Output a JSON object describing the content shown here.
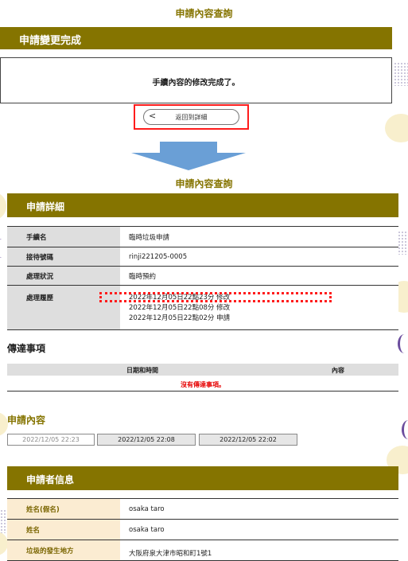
{
  "header": {
    "title": "申請內容查詢"
  },
  "banner": {
    "label": "申請變更完成"
  },
  "completion": {
    "message": "手續內容的修改完成了。"
  },
  "back_button": {
    "chevron": "<",
    "label": "返回到詳細"
  },
  "detail_section": {
    "title": "申請內容查詢",
    "band_label": "申請詳細",
    "rows": [
      {
        "label": "手續名",
        "value": "臨時垃圾申請"
      },
      {
        "label": "接待號碼",
        "value": "rinji221205-0005"
      },
      {
        "label": "處理狀況",
        "value": "臨時預約"
      },
      {
        "label": "處理履歷",
        "history": [
          "2022年12月05日22點23分 修改",
          "2022年12月05日22點08分 修改",
          "2022年12月05日22點02分 申請"
        ]
      }
    ]
  },
  "messages": {
    "heading": "傳達事項",
    "col_datetime": "日期和時間",
    "col_content": "內容",
    "empty": "沒有傳達事項。"
  },
  "application_content": {
    "heading": "申請內容",
    "versions": [
      "2022/12/05 22:23",
      "2022/12/05 22:08",
      "2022/12/05 22:02"
    ]
  },
  "applicant": {
    "band_label": "申請者信息",
    "rows": [
      {
        "label": "姓名(假名)",
        "value": "osaka taro"
      },
      {
        "label": "姓名",
        "value": "osaka taro"
      },
      {
        "label": "垃圾的發生地方",
        "value": "大阪府泉大津市昭和町1號1"
      }
    ]
  },
  "colors": {
    "accent": "#857400",
    "highlight": "#ff1c1c",
    "error_text": "#e60000"
  }
}
